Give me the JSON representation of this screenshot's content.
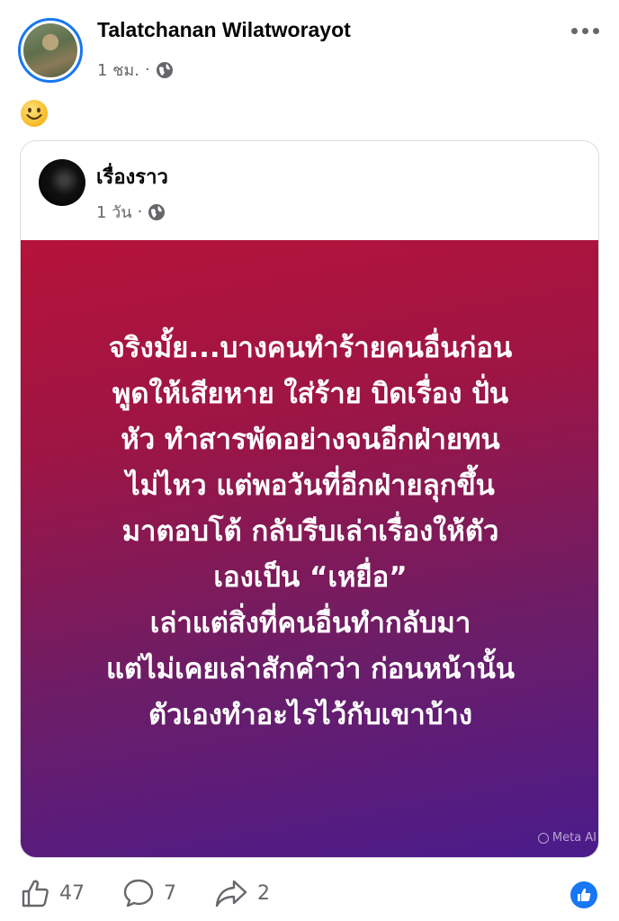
{
  "post": {
    "author": "Talatchanan Wilatworayot",
    "time": "1 ชม.",
    "separator": "·",
    "emoji": "smiling-face-emoji"
  },
  "shared": {
    "page_name": "เรื่องราว",
    "time": "1 วัน",
    "separator": "·",
    "quote_lines": [
      "จริงมั้ย...บางคนทำร้ายคนอื่นก่อน",
      "พูดให้เสียหาย ใส่ร้าย บิดเรื่อง ปั่น",
      "หัว ทำสารพัดอย่างจนอีกฝ่ายทน",
      "ไม่ไหว แต่พอวันที่อีกฝ่ายลุกขึ้น",
      "มาตอบโต้ กลับรีบเล่าเรื่องให้ตัว",
      "เองเป็น “เหยื่อ”",
      "เล่าแต่สิ่งที่คนอื่นทำกลับมา",
      "แต่ไม่เคยเล่าสักคำว่า ก่อนหน้านั้น",
      "ตัวเองทำอะไรไว้กับเขาบ้าง"
    ],
    "watermark": "Meta AI"
  },
  "footer": {
    "likes": "47",
    "comments": "7",
    "shares": "2"
  },
  "colors": {
    "accent": "#1877f2",
    "muted": "#65676b",
    "gradient_top": "#b5133a",
    "gradient_bottom": "#4a1c8c"
  }
}
